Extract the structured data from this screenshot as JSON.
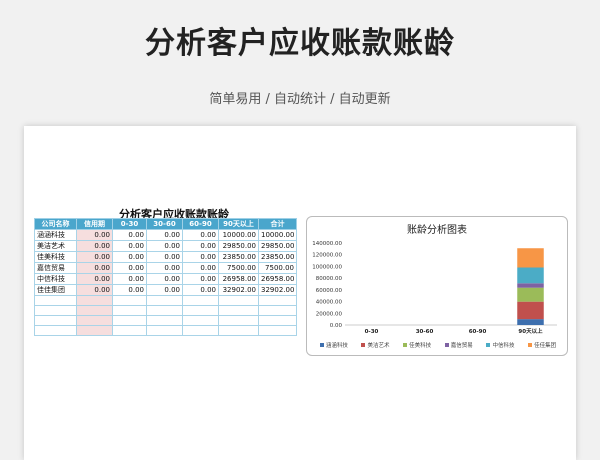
{
  "hero": {
    "title": "分析客户应收账款账龄",
    "subtitle": "简单易用 / 自动统计 / 自动更新"
  },
  "sheet": {
    "title": "分析客户应收账款账龄",
    "columns": [
      "公司名称",
      "信用期",
      "0-30",
      "30-60",
      "60-90",
      "90天以上",
      "合计"
    ],
    "rows": [
      [
        "涵涵科技",
        "0.00",
        "0.00",
        "0.00",
        "0.00",
        "10000.00",
        "10000.00"
      ],
      [
        "美洁艺术",
        "0.00",
        "0.00",
        "0.00",
        "0.00",
        "29850.00",
        "29850.00"
      ],
      [
        "佳美科技",
        "0.00",
        "0.00",
        "0.00",
        "0.00",
        "23850.00",
        "23850.00"
      ],
      [
        "嘉信贸易",
        "0.00",
        "0.00",
        "0.00",
        "0.00",
        "7500.00",
        "7500.00"
      ],
      [
        "中信科技",
        "0.00",
        "0.00",
        "0.00",
        "0.00",
        "26958.00",
        "26958.00"
      ],
      [
        "佳佳集团",
        "0.00",
        "0.00",
        "0.00",
        "0.00",
        "32902.00",
        "32902.00"
      ]
    ],
    "empty_rows": 4
  },
  "chart_data": {
    "type": "bar",
    "stacked": true,
    "title": "账龄分析图表",
    "categories": [
      "0-30",
      "30-60",
      "60-90",
      "90天以上"
    ],
    "ylim": [
      0,
      140000
    ],
    "yticks": [
      "0.00",
      "20000.00",
      "40000.00",
      "60000.00",
      "80000.00",
      "100000.00",
      "120000.00",
      "140000.00"
    ],
    "series": [
      {
        "name": "涵涵科技",
        "color": "#3d6fae",
        "values": [
          0,
          0,
          0,
          10000
        ]
      },
      {
        "name": "美洁艺术",
        "color": "#c0504d",
        "values": [
          0,
          0,
          0,
          29850
        ]
      },
      {
        "name": "佳美科技",
        "color": "#9bbb59",
        "values": [
          0,
          0,
          0,
          23850
        ]
      },
      {
        "name": "嘉信贸易",
        "color": "#7e62a3",
        "values": [
          0,
          0,
          0,
          7500
        ]
      },
      {
        "name": "中信科技",
        "color": "#4bacc6",
        "values": [
          0,
          0,
          0,
          26958
        ]
      },
      {
        "name": "佳佳集团",
        "color": "#f79646",
        "values": [
          0,
          0,
          0,
          32902
        ]
      }
    ],
    "legend": "bottom",
    "grid": false
  }
}
